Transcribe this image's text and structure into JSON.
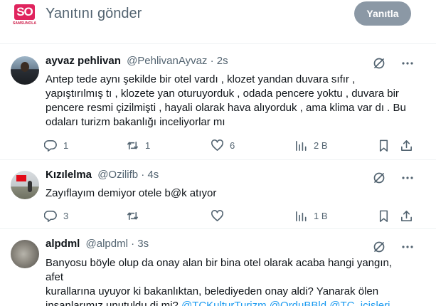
{
  "composer": {
    "logo_text": "SO",
    "logo_subtext": "SAMSUNOLAY",
    "placeholder": "Yanıtını gönder",
    "reply_button": "Yanıtla"
  },
  "tweets": [
    {
      "name": "ayvaz pehlivan",
      "handle": "@PehlivanAyvaz",
      "separator": "·",
      "time": "2s",
      "text": "Antep tede aynı şekilde bir otel vardı , klozet  yandan duvara sıfır ,\nyapıştırılmış tı , klozete yan oturuyorduk , odada pencere yoktu , duvara bir\npencere  resmi  çizilmişti , hayali olarak hava alıyorduk , ama klima var dı . Bu\nodaları turizm bakanlığı inceliyorlar mı",
      "replies": "1",
      "retweets": "1",
      "likes": "6",
      "views": "2 B"
    },
    {
      "name": "Kızılelma",
      "handle": "@Ozilifb",
      "separator": "·",
      "time": "4s",
      "text": "Zayıflayım demiyor otele b@k atıyor",
      "replies": "3",
      "retweets": "",
      "likes": "",
      "views": "1 B"
    },
    {
      "name": "alpdml",
      "handle": "@alpdml",
      "separator": "·",
      "time": "3s",
      "text": "Banyosu böyle olup da onay alan bir bina otel olarak acaba hangi yangın, afet\nkurallarına uyuyor ki bakanlıktan, belediyeden onay aldi? Yanarak ölen\ninsanlarımız unutuldu di mi? ",
      "mentions": [
        "@TCKulturTurizm",
        "@OrduBBld",
        "@TC_icisleri"
      ]
    }
  ],
  "icons": {
    "reply": "reply-icon",
    "retweet": "retweet-icon",
    "like": "heart-icon",
    "views": "views-icon",
    "bookmark": "bookmark-icon",
    "share": "share-icon",
    "grok": "grok-icon",
    "more": "more-icon"
  },
  "colors": {
    "link": "#1d9bf0",
    "secondary_text": "#536471",
    "button_disabled": "#8b98a5",
    "logo": "#e0245e"
  }
}
